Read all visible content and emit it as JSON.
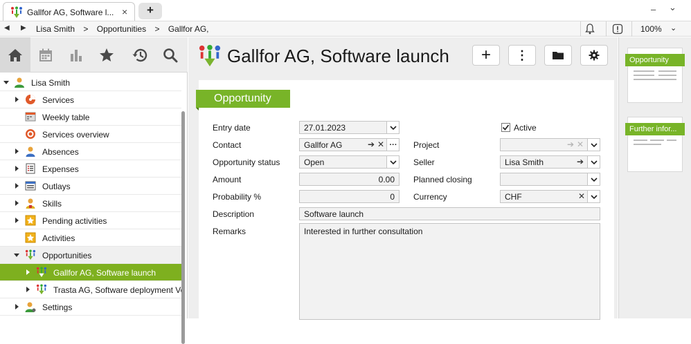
{
  "tab": {
    "title": "Gallfor AG, Software l...",
    "close": "×",
    "new": "+"
  },
  "window": {
    "minimize": "–",
    "chevron": "⌄"
  },
  "addressbar": {
    "crumbs": [
      "Lisa Smith",
      ">",
      "Opportunities",
      ">",
      "Gallfor AG, Sc"
    ],
    "zoom": "100%"
  },
  "toolbar": {
    "items": [
      {
        "name": "home",
        "icon": "home-icon",
        "selected": true
      },
      {
        "name": "calendar",
        "icon": "calendar-icon"
      },
      {
        "name": "reports",
        "icon": "bar-chart-icon"
      },
      {
        "name": "favorites",
        "icon": "star-icon"
      },
      {
        "name": "history",
        "icon": "history-icon"
      },
      {
        "name": "search",
        "icon": "search-icon"
      }
    ]
  },
  "tree": {
    "root": {
      "label": "Lisa Smith",
      "icon": "user-icon"
    },
    "items": [
      {
        "label": "Services",
        "icon": "services-icon",
        "expandable": true
      },
      {
        "label": "Weekly table",
        "icon": "weekly-table-icon",
        "expandable": false
      },
      {
        "label": "Services overview",
        "icon": "target-icon",
        "expandable": false
      },
      {
        "label": "Absences",
        "icon": "absences-icon",
        "expandable": true
      },
      {
        "label": "Expenses",
        "icon": "expenses-icon",
        "expandable": true
      },
      {
        "label": "Outlays",
        "icon": "outlays-icon",
        "expandable": true
      },
      {
        "label": "Skills",
        "icon": "skills-icon",
        "expandable": true
      },
      {
        "label": "Pending activities",
        "icon": "pending-icon",
        "expandable": true
      },
      {
        "label": "Activities",
        "icon": "activities-icon",
        "expandable": false
      },
      {
        "label": "Opportunities",
        "icon": "opportunities-icon",
        "expandable": true,
        "expanded": true
      },
      {
        "label": "Gallfor AG, Software launch",
        "icon": "opportunity-icon",
        "expandable": true,
        "selected": true,
        "child": true
      },
      {
        "label": "Trasta AG, Software deployment Ver",
        "icon": "opportunity-icon",
        "expandable": true,
        "child": true
      },
      {
        "label": "Settings",
        "icon": "settings-user-icon",
        "expandable": true
      }
    ]
  },
  "main": {
    "title": "Gallfor AG, Software launch",
    "buttons": [
      {
        "name": "add",
        "glyph": "+"
      },
      {
        "name": "more",
        "glyph": "⋮"
      },
      {
        "name": "folder",
        "glyph": "folder"
      },
      {
        "name": "settings",
        "glyph": "gear"
      }
    ],
    "section": "Opportunity",
    "fields": {
      "entry_date": {
        "label": "Entry date",
        "value": "27.01.2023"
      },
      "active": {
        "label": "Active",
        "checked": true
      },
      "contact": {
        "label": "Contact",
        "value": "Gallfor AG"
      },
      "project": {
        "label": "Project",
        "value": ""
      },
      "status": {
        "label": "Opportunity status",
        "value": "Open"
      },
      "seller": {
        "label": "Seller",
        "value": "Lisa Smith"
      },
      "amount": {
        "label": "Amount",
        "value": "0.00"
      },
      "planned_closing": {
        "label": "Planned closing",
        "value": ""
      },
      "probability": {
        "label": "Probability %",
        "value": "0"
      },
      "currency": {
        "label": "Currency",
        "value": "CHF"
      },
      "description": {
        "label": "Description",
        "value": "Software launch"
      },
      "remarks": {
        "label": "Remarks",
        "value": "Interested in further consultation"
      }
    }
  },
  "thumbnails": [
    {
      "label": "Opportunity"
    },
    {
      "label": "Further infor..."
    }
  ],
  "colors": {
    "accent": "#78b428",
    "selected_row": "#7eb01f"
  }
}
